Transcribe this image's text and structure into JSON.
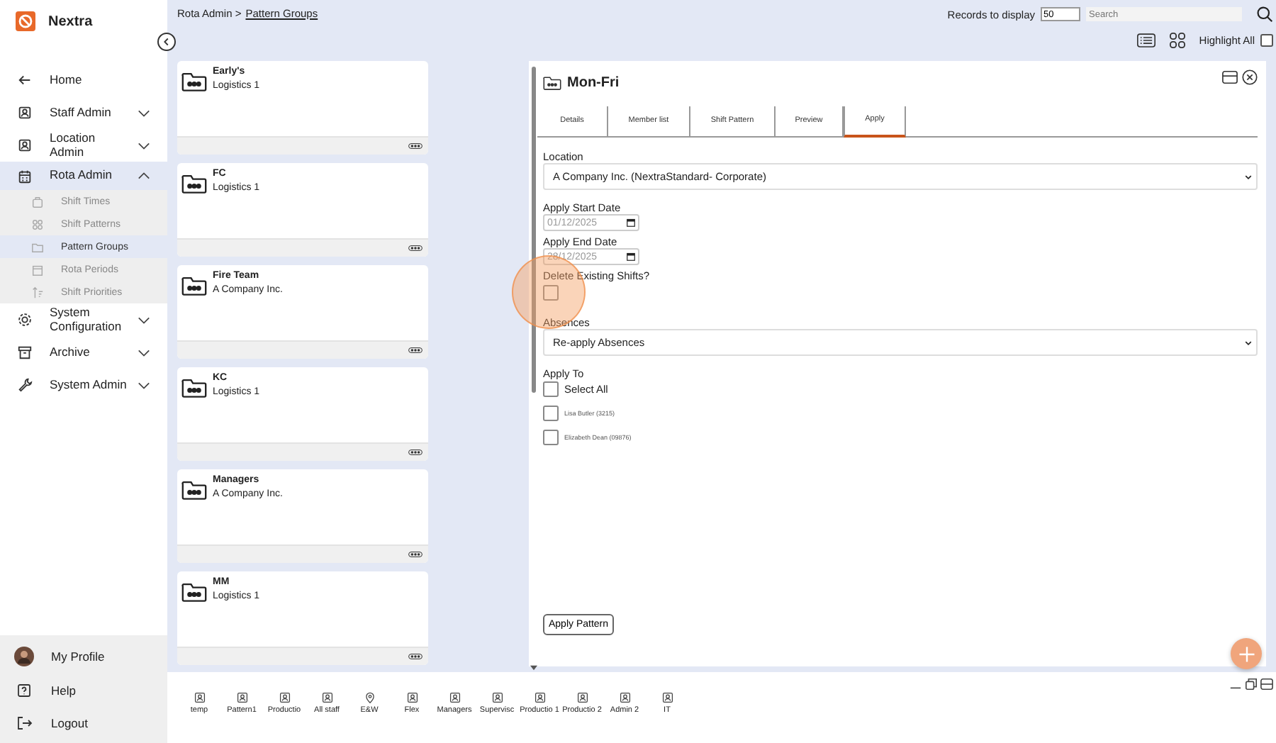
{
  "app": {
    "name": "Nextra"
  },
  "sidebar": {
    "items": [
      {
        "label": "Home",
        "selected": false
      },
      {
        "label": "Staff Admin",
        "selected": false,
        "expanded": false
      },
      {
        "label": "Location Admin",
        "selected": false,
        "expanded": false
      },
      {
        "label": "Rota Admin",
        "selected": true,
        "expanded": true,
        "children": [
          {
            "label": "Shift Times",
            "selected": false
          },
          {
            "label": "Shift Patterns",
            "selected": false
          },
          {
            "label": "Pattern Groups",
            "selected": true
          },
          {
            "label": "Rota Periods",
            "selected": false
          },
          {
            "label": "Shift Priorities",
            "selected": false
          }
        ]
      },
      {
        "label": "System Configuration",
        "selected": false,
        "expanded": false
      },
      {
        "label": "Archive",
        "selected": false,
        "expanded": false
      },
      {
        "label": "System Admin",
        "selected": false,
        "expanded": false
      }
    ],
    "footer": [
      {
        "label": "My Profile"
      },
      {
        "label": "Help"
      },
      {
        "label": "Logout"
      }
    ]
  },
  "breadcrumb": {
    "parent": "Rota Admin >",
    "current": "Pattern Groups"
  },
  "toolbar": {
    "records_label": "Records to display",
    "records_value": "50",
    "search_placeholder": "Search",
    "highlight_label": "Highlight All",
    "highlight_checked": false
  },
  "groups": [
    {
      "name": "Early's",
      "location": "Logistics 1"
    },
    {
      "name": "FC",
      "location": "Logistics 1"
    },
    {
      "name": "Fire Team",
      "location": "A Company Inc."
    },
    {
      "name": "KC",
      "location": "Logistics 1"
    },
    {
      "name": "Managers",
      "location": "A Company Inc."
    },
    {
      "name": "MM",
      "location": "Logistics 1"
    }
  ],
  "detail": {
    "title": "Mon-Fri",
    "tabs": [
      {
        "label": "Details",
        "selected": false
      },
      {
        "label": "Member list",
        "selected": false
      },
      {
        "label": "Shift Pattern",
        "selected": false
      },
      {
        "label": "Preview",
        "selected": false
      },
      {
        "label": "Apply",
        "selected": true
      }
    ],
    "location_label": "Location",
    "location_value": "A Company Inc. (NextraStandard- Corporate)",
    "start_label": "Apply Start Date",
    "start_value": "01/12/2025",
    "end_label": "Apply End Date",
    "end_value": "28/12/2025",
    "delete_label": "Delete Existing Shifts?",
    "delete_checked": false,
    "absences_label": "Absences",
    "absences_value": "Re-apply Absences",
    "apply_to_label": "Apply To",
    "select_all_label": "Select All",
    "select_all_checked": false,
    "members": [
      {
        "label": "Lisa Butler (3215)",
        "checked": false
      },
      {
        "label": "Elizabeth Dean (09876)",
        "checked": false
      }
    ],
    "apply_button": "Apply Pattern"
  },
  "shortcuts": [
    {
      "label": "temp",
      "kind": "person"
    },
    {
      "label": "Pattern1",
      "kind": "person"
    },
    {
      "label": "Productio",
      "kind": "person"
    },
    {
      "label": "All staff",
      "kind": "person"
    },
    {
      "label": "E&W",
      "kind": "pin"
    },
    {
      "label": "Flex",
      "kind": "person"
    },
    {
      "label": "Managers",
      "kind": "person"
    },
    {
      "label": "Supervisc",
      "kind": "person"
    },
    {
      "label": "Productio 1",
      "kind": "person"
    },
    {
      "label": "Productio 2",
      "kind": "person"
    },
    {
      "label": "Admin 2",
      "kind": "person"
    },
    {
      "label": "IT",
      "kind": "person"
    }
  ]
}
